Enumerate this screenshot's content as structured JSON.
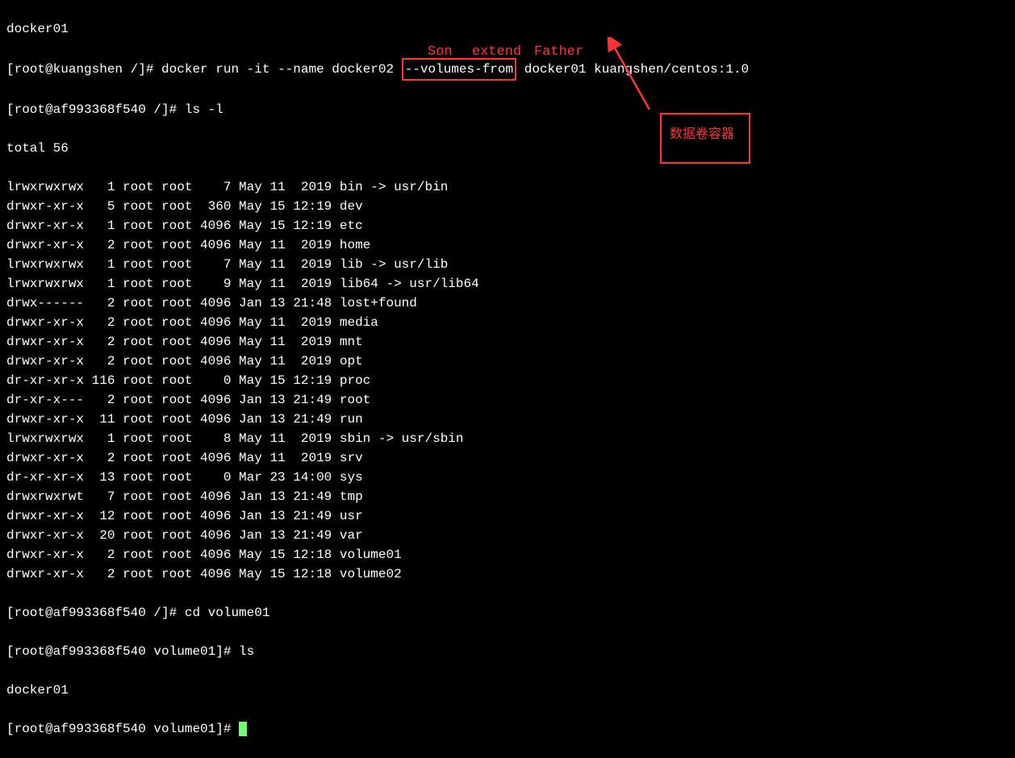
{
  "header": "docker01",
  "line1_prompt": "[root@kuangshen /]# ",
  "line1_cmd_part1": "docker run -it --name docker02 ",
  "line1_highlight": "--volumes-from",
  "line1_cmd_part2": " docker01 kuangshen/centos:1.0",
  "line2": "[root@af993368f540 /]# ls -l",
  "total": "total 56",
  "listing": [
    "lrwxrwxrwx   1 root root    7 May 11  2019 bin -> usr/bin",
    "drwxr-xr-x   5 root root  360 May 15 12:19 dev",
    "drwxr-xr-x   1 root root 4096 May 15 12:19 etc",
    "drwxr-xr-x   2 root root 4096 May 11  2019 home",
    "lrwxrwxrwx   1 root root    7 May 11  2019 lib -> usr/lib",
    "lrwxrwxrwx   1 root root    9 May 11  2019 lib64 -> usr/lib64",
    "drwx------   2 root root 4096 Jan 13 21:48 lost+found",
    "drwxr-xr-x   2 root root 4096 May 11  2019 media",
    "drwxr-xr-x   2 root root 4096 May 11  2019 mnt",
    "drwxr-xr-x   2 root root 4096 May 11  2019 opt",
    "dr-xr-xr-x 116 root root    0 May 15 12:19 proc",
    "dr-xr-x---   2 root root 4096 Jan 13 21:49 root",
    "drwxr-xr-x  11 root root 4096 Jan 13 21:49 run",
    "lrwxrwxrwx   1 root root    8 May 11  2019 sbin -> usr/sbin",
    "drwxr-xr-x   2 root root 4096 May 11  2019 srv",
    "dr-xr-xr-x  13 root root    0 Mar 23 14:00 sys",
    "drwxrwxrwt   7 root root 4096 Jan 13 21:49 tmp",
    "drwxr-xr-x  12 root root 4096 Jan 13 21:49 usr",
    "drwxr-xr-x  20 root root 4096 Jan 13 21:49 var",
    "drwxr-xr-x   2 root root 4096 May 15 12:18 volume01",
    "drwxr-xr-x   2 root root 4096 May 15 12:18 volume02"
  ],
  "line_cd": "[root@af993368f540 /]# cd volume01",
  "line_ls": "[root@af993368f540 volume01]# ls",
  "ls_output": "docker01",
  "line_final": "[root@af993368f540 volume01]# ",
  "annotation_son": "Son",
  "annotation_extend": "extend",
  "annotation_father": "Father",
  "callout_text": "数据卷容器"
}
